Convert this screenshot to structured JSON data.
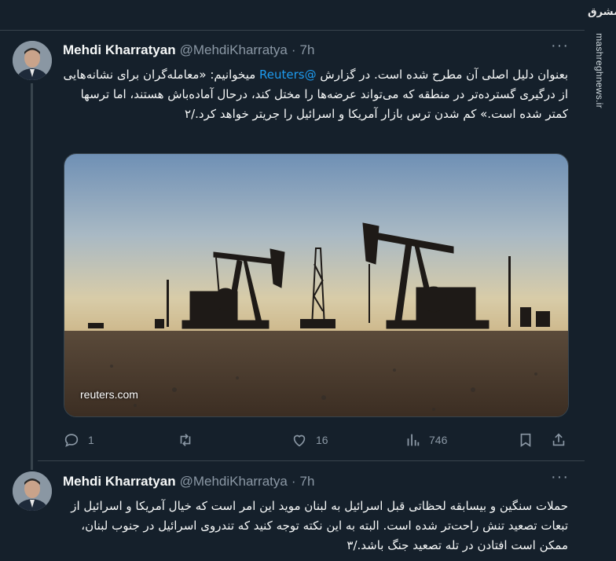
{
  "brand": {
    "logo_text": "مشرق",
    "site": "mashreghnews.ir"
  },
  "tweets": [
    {
      "name": "Mehdi Kharratyan",
      "handle": "@MehdiKharratya",
      "separator": "·",
      "time": "7h",
      "text_before": "بعنوان دلیل اصلی آن مطرح شده است. در گزارش ",
      "mention": "@Reuters",
      "text_after": " میخوانیم: «معامله‌گران برای نشانه‌هایی از درگیری گسترده‌تر در منطقه که می‌تواند عرضه‌ها را مختل کند، درحال آماده‌باش هستند، اما ترسها کمتر شده است.» کم شدن ترس بازار آمریکا و اسرائیل را جریتر خواهد کرد./۲",
      "media_link": "reuters.com",
      "actions": {
        "replies": "1",
        "retweets": "",
        "likes": "16",
        "views": "746"
      }
    },
    {
      "name": "Mehdi Kharratyan",
      "handle": "@MehdiKharratya",
      "separator": "·",
      "time": "7h",
      "text": "حملات سنگین و بیسابقه لحظاتی قبل اسرائیل به لبنان موید این امر است که خیال آمریکا و اسرائیل از تبعات تصعید تنش راحت‌تر شده است. البته به این نکته توجه کنید که تندروی اسرائیل در جنوب لبنان، ممکن است افتادن در تله تصعید جنگ باشد./۳"
    }
  ]
}
